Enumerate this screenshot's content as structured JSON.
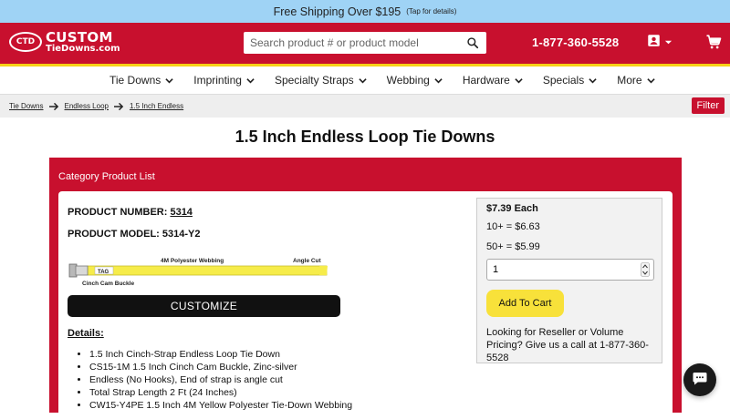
{
  "promo": {
    "main": "Free Shipping Over $195",
    "tap": "(Tap for details)"
  },
  "header": {
    "logo_ctd": "CTD",
    "logo_word1": "CUSTOM",
    "logo_word2": "TieDowns.com",
    "search_placeholder": "Search product # or product model",
    "phone": "1-877-360-5528",
    "colors": {
      "brand_red": "#c8102e",
      "accent_yellow": "#f7d117",
      "promo_blue": "#9fd3f5"
    }
  },
  "nav": {
    "items": [
      {
        "label": "Tie Downs"
      },
      {
        "label": "Imprinting"
      },
      {
        "label": "Specialty Straps"
      },
      {
        "label": "Webbing"
      },
      {
        "label": "Hardware"
      },
      {
        "label": "Specials"
      },
      {
        "label": "More"
      }
    ]
  },
  "breadcrumb": {
    "items": [
      "Tie Downs",
      "Endless Loop",
      "1.5 Inch Endless"
    ],
    "filter_label": "Filter"
  },
  "page": {
    "title": "1.5 Inch Endless Loop Tie Downs"
  },
  "category": {
    "title": "Category Product List",
    "product": {
      "number_label": "PRODUCT NUMBER:",
      "number": "5314",
      "model_label": "PRODUCT MODEL:",
      "model": "5314-Y2",
      "image_labels": {
        "webbing": "4M Polyester Webbing",
        "cut": "Angle Cut",
        "tag": "TAG",
        "buckle": "Cinch Cam Buckle"
      },
      "customize_label": "CUSTOMIZE",
      "details_heading": "Details:",
      "details": [
        "1.5 Inch Cinch-Strap Endless Loop Tie Down",
        "CS15-1M 1.5 Inch Cinch Cam Buckle, Zinc-silver",
        "Endless (No Hooks), End of strap is angle cut",
        "Total Strap Length 2 Ft (24 Inches)",
        "CW15-Y4PE 1.5 Inch 4M Yellow Polyester Tie-Down Webbing"
      ]
    },
    "pricing": {
      "each": "$7.39 Each",
      "tier1": "10+ = $6.63",
      "tier2": "50+ = $5.99",
      "qty_value": "1",
      "add_to_cart": "Add To Cart",
      "reseller_text": "Looking for Reseller or Volume Pricing? Give us a call at 1-877-360-5528"
    }
  }
}
